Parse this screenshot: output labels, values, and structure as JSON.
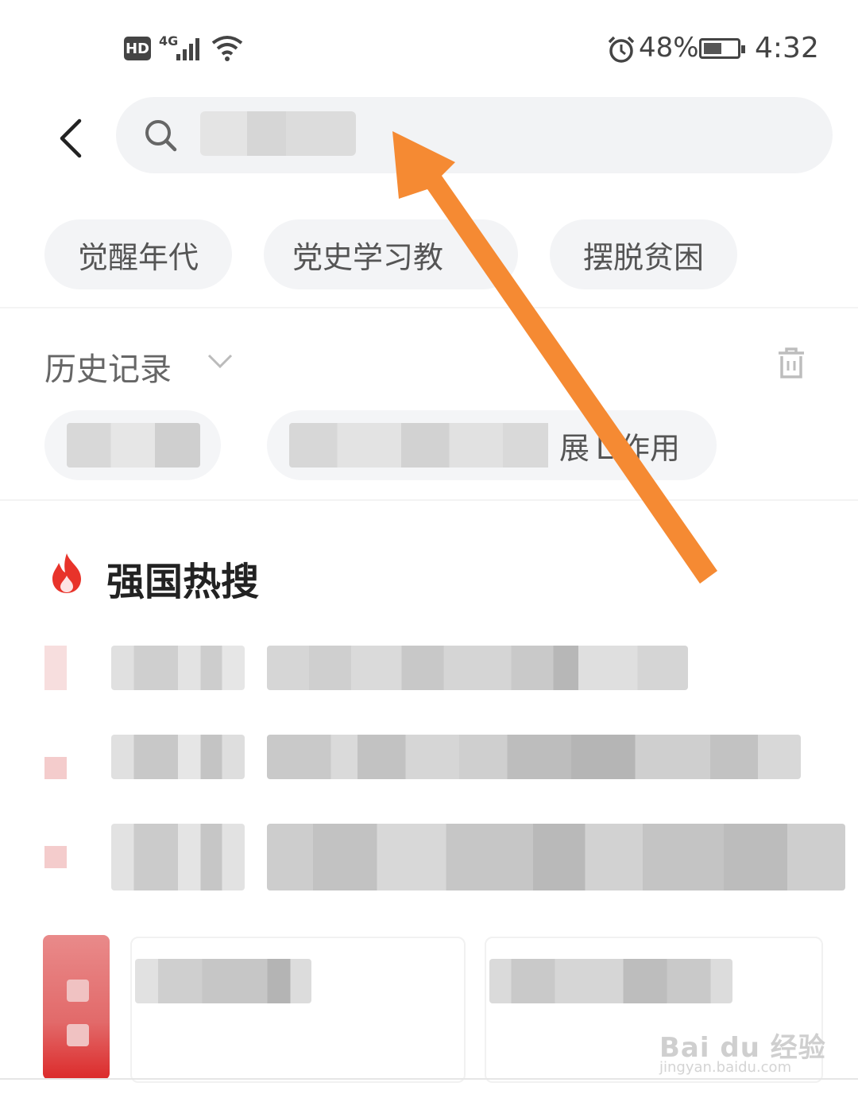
{
  "status_bar": {
    "hd": "HD",
    "network": "4G",
    "battery_percent": "48%",
    "time": "4:32"
  },
  "search": {
    "placeholder": ""
  },
  "hot_keywords": [
    "觉醒年代",
    "党史学习教育",
    "摆脱贫困"
  ],
  "hot_keyword_visible": [
    "觉醒年代",
    "党史学习教",
    "摆脱贫困"
  ],
  "history": {
    "title": "历史记录",
    "items_visible_tail": "展Ｌ作用"
  },
  "hot_search": {
    "title": "强国热搜"
  },
  "watermark": {
    "line1": "Bai du 经验",
    "line2": "jingyan.baidu.com"
  },
  "colors": {
    "arrow": "#f58a33",
    "fire": "#e8332a",
    "chip_bg": "#f3f4f6"
  }
}
